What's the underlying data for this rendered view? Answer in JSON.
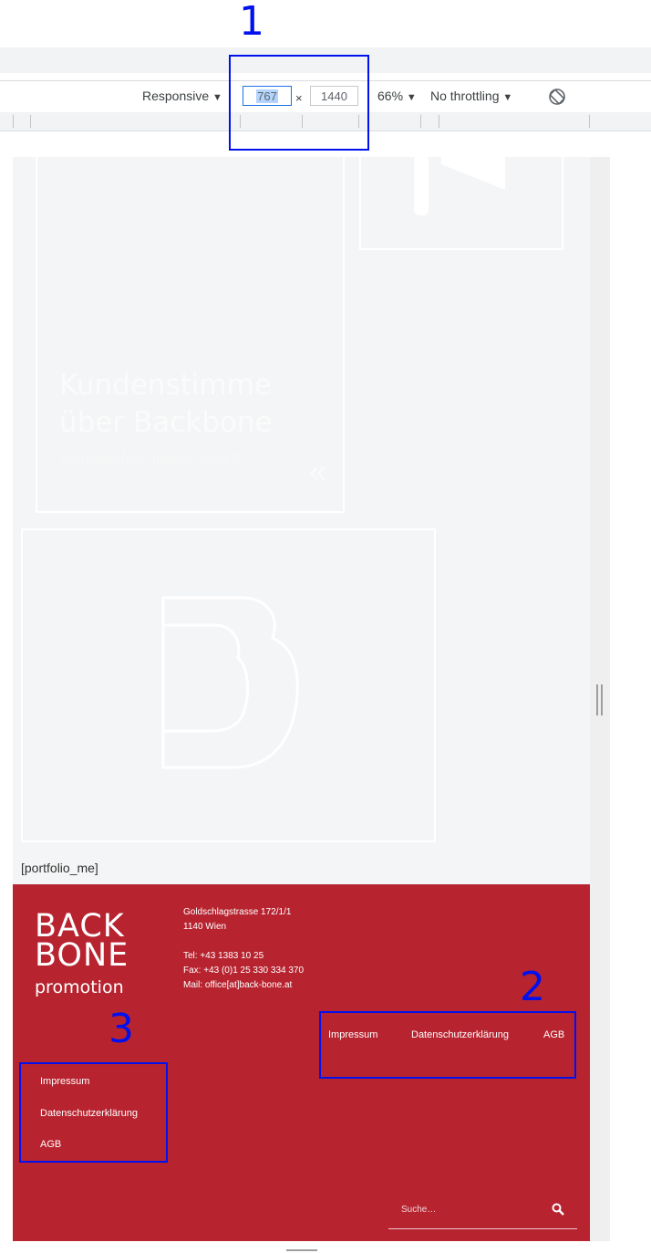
{
  "devtools": {
    "device_mode": "Responsive",
    "width_value": "767",
    "times_sign": "×",
    "height_value": "1440",
    "zoom": "66%",
    "throttling": "No throttling",
    "dropdown_arrow": "▼",
    "rotate_icon": "rotate-icon"
  },
  "page": {
    "testimonial": {
      "title_line1": "Kundenstimme",
      "title_line2": "über Backbone",
      "subtitle": "Vorname Nachname, Kunde",
      "quote_mark": "«"
    },
    "portfolio_shortcode": "[portfolio_me]"
  },
  "footer": {
    "logo": {
      "line1": "BACK",
      "line2": "BONE",
      "line3": "promotion"
    },
    "address": {
      "street": "Goldschlagstrasse 172/1/1",
      "city": "1140 Wien"
    },
    "contact": {
      "tel": "Tel: +43 1383 10 25",
      "fax": "Fax: +43 (0)1 25 330 334 370",
      "mail": "Mail: office[at]back-bone.at"
    },
    "menu_horizontal": [
      "Impressum",
      "Datenschutzerklärung",
      "AGB"
    ],
    "menu_vertical": [
      "Impressum",
      "Datenschutzerklärung",
      "AGB"
    ],
    "search": {
      "placeholder": "Suche…"
    },
    "colors": {
      "background": "#b72430"
    }
  },
  "annotations": [
    "1",
    "2",
    "3"
  ]
}
